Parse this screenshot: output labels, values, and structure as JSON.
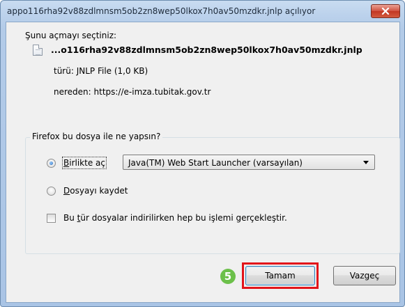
{
  "window": {
    "title": "appo116rha92v88zdlmnsm5ob2zn8wep50lkox7h0av50mzdkr.jnlp açılıyor"
  },
  "dialog": {
    "prompt": "Şunu açmayı seçtiniz:",
    "file_name": "...o116rha92v88zdlmnsm5ob2zn8wep50lkox7h0av50mzdkr.jnlp",
    "type_line": "türü: JNLP File (1,0 KB)",
    "source_line": "nereden: https://e-imza.tubitak.gov.tr"
  },
  "group": {
    "legend": "Firefox bu dosya ile ne yapsın?",
    "open_with": {
      "label_underlined": "B",
      "label_rest": "irlikte aç",
      "checked": true,
      "selected_app": "Java(TM) Web Start Launcher (varsayılan)"
    },
    "save": {
      "label_underlined": "D",
      "label_rest": "osyayı kaydet",
      "checked": false
    },
    "remember": {
      "label_before": "Bu ",
      "label_underlined": "t",
      "label_after": "ür dosyalar indirilirken hep bu işlemi gerçekleştir.",
      "checked": false
    }
  },
  "buttons": {
    "ok_label": "Tamam",
    "cancel_label": "Vazgeç"
  },
  "annotation": {
    "step_number": "5",
    "badge_color": "#6cc04a",
    "highlight_color": "#e2141a"
  }
}
